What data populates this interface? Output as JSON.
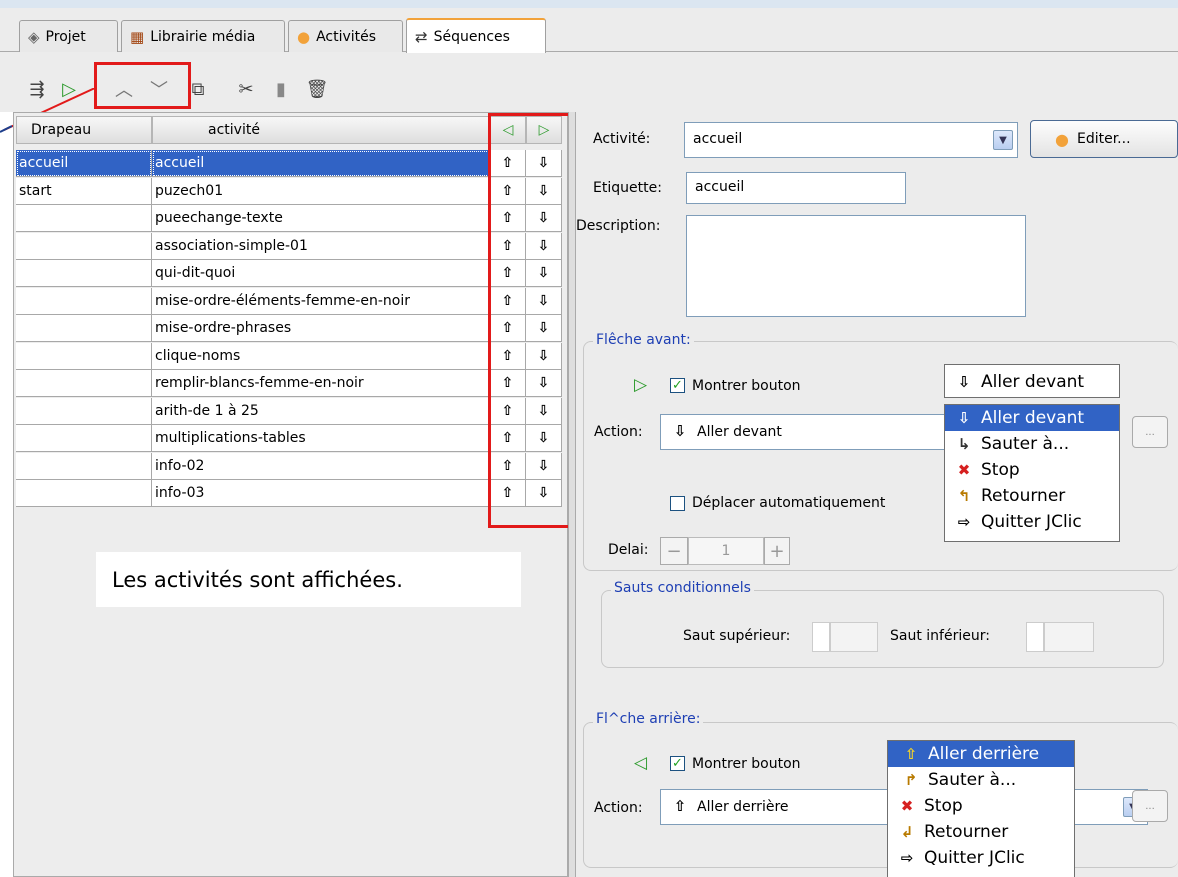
{
  "tabs": [
    {
      "label": "Projet",
      "icon": "project-icon"
    },
    {
      "label": "Librairie média",
      "icon": "media-library-icon"
    },
    {
      "label": "Activités",
      "icon": "activities-icon"
    },
    {
      "label": "Séquences",
      "icon": "sequences-icon",
      "active": true
    }
  ],
  "toolbar": {
    "icons": [
      "new-sequence-icon",
      "play-icon",
      "move-up-icon",
      "move-down-icon",
      "copy-icon",
      "cut-icon",
      "paste-icon",
      "delete-icon"
    ]
  },
  "table": {
    "headers": [
      "Drapeau",
      "activité"
    ],
    "rows": [
      {
        "flag": "accueil",
        "activity": "accueil",
        "selected": true
      },
      {
        "flag": "start",
        "activity": "puzech01"
      },
      {
        "flag": "",
        "activity": "pueechange-texte"
      },
      {
        "flag": "",
        "activity": "association-simple-01"
      },
      {
        "flag": "",
        "activity": "qui-dit-quoi"
      },
      {
        "flag": "",
        "activity": "mise-ordre-éléments-femme-en-noir"
      },
      {
        "flag": "",
        "activity": "mise-ordre-phrases"
      },
      {
        "flag": "",
        "activity": "clique-noms"
      },
      {
        "flag": "",
        "activity": "remplir-blancs-femme-en-noir"
      },
      {
        "flag": "",
        "activity": "arith-de 1 à 25"
      },
      {
        "flag": "",
        "activity": "multiplications-tables"
      },
      {
        "flag": "",
        "activity": "info-02"
      },
      {
        "flag": "",
        "activity": "info-03"
      }
    ]
  },
  "message": "Les activités sont affichées.",
  "form": {
    "activity_label": "Activité:",
    "activity_value": "accueil",
    "edit_button": "Editer...",
    "tag_label": "Etiquette:",
    "tag_value": "accueil",
    "description_label": "Description:"
  },
  "forward": {
    "title": "Flêche avant:",
    "show_button": "Montrer bouton",
    "action_label": "Action:",
    "action_value": "Aller devant",
    "auto_move": "Déplacer automatiquement",
    "delay_label": "Delai:",
    "delay_value": "1",
    "dropdown_current": "Aller devant",
    "menu": [
      "Aller devant",
      "Sauter à...",
      "Stop",
      "Retourner",
      "Quitter JClic"
    ]
  },
  "conditional": {
    "title": "Sauts conditionnels",
    "upper_label": "Saut supérieur:",
    "lower_label": "Saut inférieur:"
  },
  "backward": {
    "title": "Fl^che arrière:",
    "show_button": "Montrer bouton",
    "action_label": "Action:",
    "action_value": "Aller derrière",
    "menu": [
      "Aller derrière",
      "Sauter à...",
      "Stop",
      "Retourner",
      "Quitter JClic"
    ]
  },
  "colors": {
    "selection": "#3163c5",
    "highlight_red": "#e21a1a",
    "group_title": "#1e3fb4"
  }
}
